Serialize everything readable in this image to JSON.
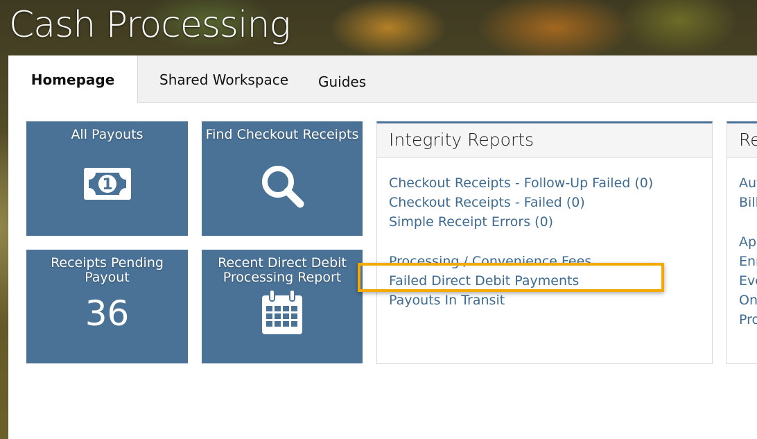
{
  "app": {
    "title": "Cash Processing"
  },
  "tabs": [
    {
      "label": "Homepage"
    },
    {
      "label": "Shared Workspace"
    },
    {
      "label": "Guides"
    }
  ],
  "tiles": {
    "all_payouts": {
      "label": "All Payouts",
      "icon": "cash-icon"
    },
    "find_checkout_receipts": {
      "label": "Find Checkout Receipts",
      "icon": "search-icon"
    },
    "receipts_pending_payout": {
      "label": "Receipts Pending Payout",
      "count": "36"
    },
    "recent_direct_debit": {
      "label": "Recent Direct Debit Processing Report",
      "icon": "calendar-icon"
    }
  },
  "integrity_reports": {
    "title": "Integrity Reports",
    "links": [
      "Checkout Receipts - Follow-Up Failed  (0)",
      "Checkout Receipts - Failed  (0)",
      "Simple Receipt Errors  (0)",
      "Processing / Convenience Fees",
      "Failed Direct Debit Payments",
      "Payouts In Transit"
    ]
  },
  "second_reports": {
    "title": "Re",
    "links": [
      "Aut",
      "Bill",
      "App",
      "Enr",
      "Eve",
      "Onl",
      "Pro"
    ]
  },
  "colors": {
    "tile_blue": "#4a7297",
    "link_blue": "#3e6b93",
    "highlight_orange": "#f2a900"
  }
}
